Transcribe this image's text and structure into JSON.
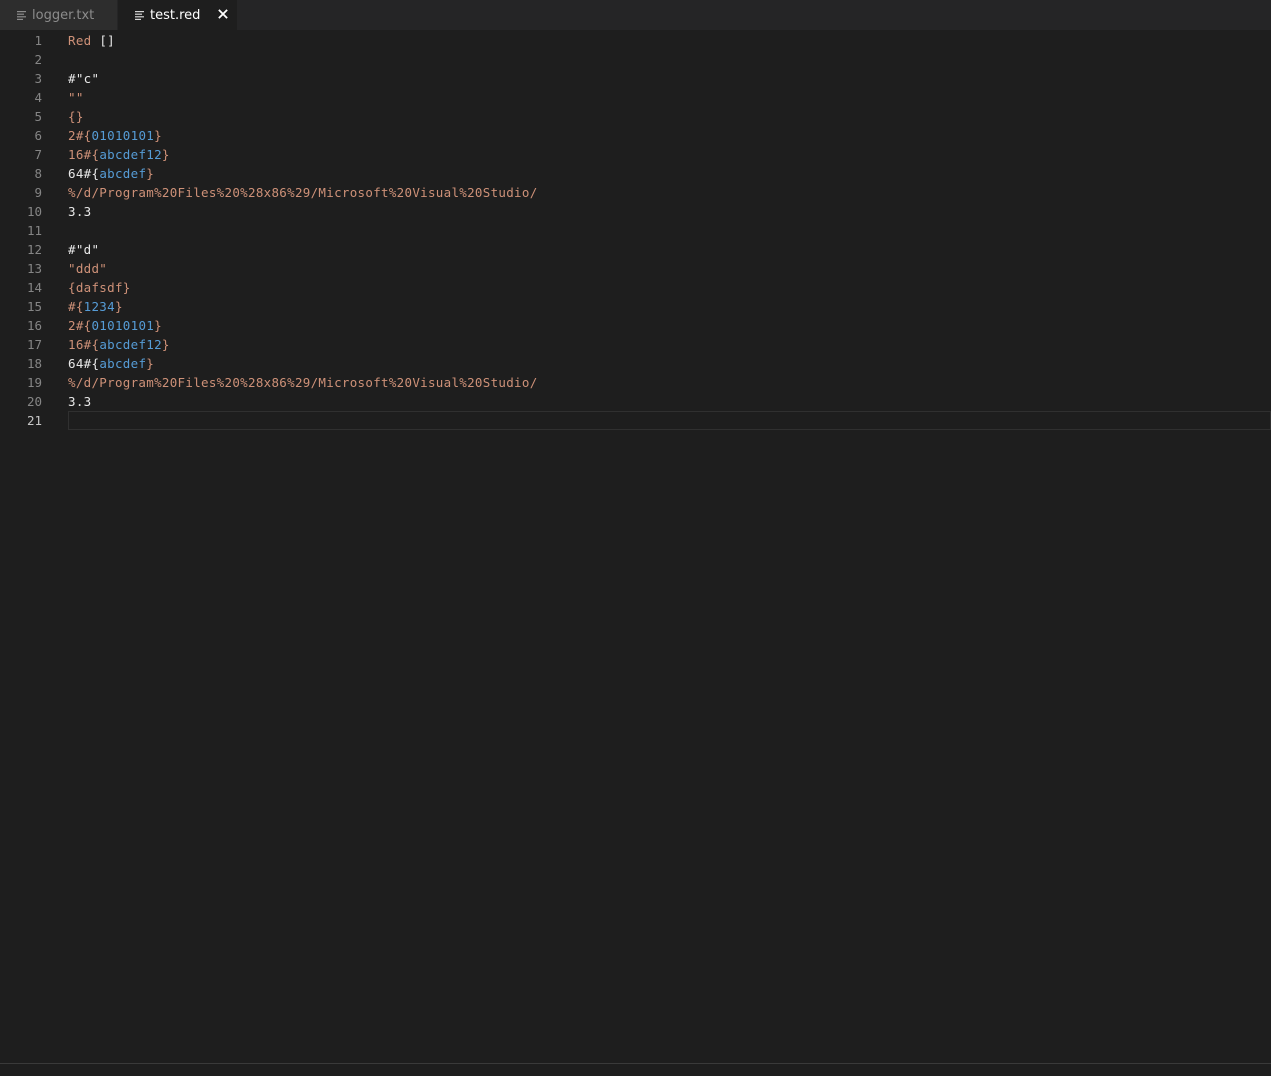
{
  "tabs": [
    {
      "label": "logger.txt",
      "icon": "file-lines-icon",
      "active": false
    },
    {
      "label": "test.red",
      "icon": "file-lines-icon",
      "active": true
    }
  ],
  "close_icon": "close-icon",
  "current_line": 21,
  "colors": {
    "background": "#1e1e1e",
    "tabbar": "#252526",
    "string": "#ce9178",
    "binary_content": "#569cd6",
    "line_number": "#858585"
  },
  "lines": [
    {
      "n": "1",
      "tokens": [
        {
          "t": "Red",
          "c": "t-orange"
        },
        {
          "t": " ",
          "c": "t-default"
        },
        {
          "t": "[]",
          "c": "t-white"
        }
      ]
    },
    {
      "n": "2",
      "tokens": []
    },
    {
      "n": "3",
      "tokens": [
        {
          "t": "#\"c\"",
          "c": "t-white"
        }
      ]
    },
    {
      "n": "4",
      "tokens": [
        {
          "t": "\"\"",
          "c": "t-orange"
        }
      ]
    },
    {
      "n": "5",
      "tokens": [
        {
          "t": "{}",
          "c": "t-orange"
        }
      ]
    },
    {
      "n": "6",
      "tokens": [
        {
          "t": "2#{",
          "c": "t-orange"
        },
        {
          "t": "01010101",
          "c": "t-blue"
        },
        {
          "t": "}",
          "c": "t-orange"
        }
      ]
    },
    {
      "n": "7",
      "tokens": [
        {
          "t": "16#{",
          "c": "t-orange"
        },
        {
          "t": "abcdef12",
          "c": "t-blue"
        },
        {
          "t": "}",
          "c": "t-orange"
        }
      ]
    },
    {
      "n": "8",
      "tokens": [
        {
          "t": "64#{",
          "c": "t-white"
        },
        {
          "t": "abcdef",
          "c": "t-blue"
        },
        {
          "t": "}",
          "c": "t-orange"
        }
      ]
    },
    {
      "n": "9",
      "tokens": [
        {
          "t": "%/d/Program%20Files%20%28x86%29/Microsoft%20Visual%20Studio/",
          "c": "t-orange"
        }
      ]
    },
    {
      "n": "10",
      "tokens": [
        {
          "t": "3.3",
          "c": "t-white"
        }
      ]
    },
    {
      "n": "11",
      "tokens": []
    },
    {
      "n": "12",
      "tokens": [
        {
          "t": "#\"d\"",
          "c": "t-white"
        }
      ]
    },
    {
      "n": "13",
      "tokens": [
        {
          "t": "\"ddd\"",
          "c": "t-orange"
        }
      ]
    },
    {
      "n": "14",
      "tokens": [
        {
          "t": "{dafsdf}",
          "c": "t-orange"
        }
      ]
    },
    {
      "n": "15",
      "tokens": [
        {
          "t": "#{",
          "c": "t-orange"
        },
        {
          "t": "1234",
          "c": "t-blue"
        },
        {
          "t": "}",
          "c": "t-orange"
        }
      ]
    },
    {
      "n": "16",
      "tokens": [
        {
          "t": "2#{",
          "c": "t-orange"
        },
        {
          "t": "01010101",
          "c": "t-blue"
        },
        {
          "t": "}",
          "c": "t-orange"
        }
      ]
    },
    {
      "n": "17",
      "tokens": [
        {
          "t": "16#{",
          "c": "t-orange"
        },
        {
          "t": "abcdef12",
          "c": "t-blue"
        },
        {
          "t": "}",
          "c": "t-orange"
        }
      ]
    },
    {
      "n": "18",
      "tokens": [
        {
          "t": "64#{",
          "c": "t-white"
        },
        {
          "t": "abcdef",
          "c": "t-blue"
        },
        {
          "t": "}",
          "c": "t-orange"
        }
      ]
    },
    {
      "n": "19",
      "tokens": [
        {
          "t": "%/d/Program%20Files%20%28x86%29/Microsoft%20Visual%20Studio/",
          "c": "t-orange"
        }
      ]
    },
    {
      "n": "20",
      "tokens": [
        {
          "t": "3.3",
          "c": "t-white"
        }
      ]
    },
    {
      "n": "21",
      "tokens": []
    }
  ]
}
